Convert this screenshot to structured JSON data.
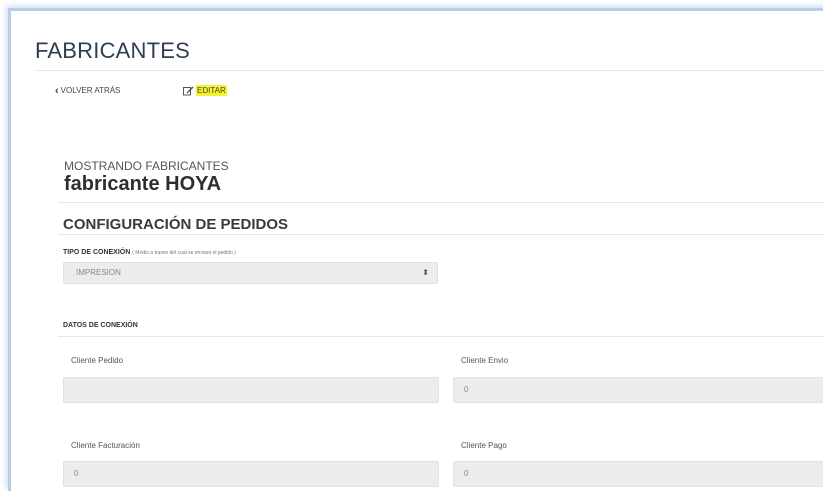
{
  "page": {
    "title": "FABRICANTES",
    "back_label": "VOLVER ATRÁS",
    "edit_label": "EDITAR"
  },
  "header": {
    "subtitle": "MOSTRANDO FABRICANTES",
    "entity_name": "fabricante HOYA"
  },
  "config": {
    "section_title": "CONFIGURACIÓN DE PEDIDOS",
    "connection_type_label": "TIPO DE CONEXIÓN",
    "connection_type_hint": "( Medio a traves del cual se enviará el pedido )",
    "connection_type_value": "IMPRESION"
  },
  "connection_data": {
    "label": "DATOS DE CONEXIÓN",
    "fields": [
      {
        "label": "Cliente Pedido",
        "value": ""
      },
      {
        "label": "Cliente Envio",
        "value": "0"
      },
      {
        "label": "Cliente Facturación",
        "value": "0"
      },
      {
        "label": "Cliente Pago",
        "value": "0"
      }
    ]
  },
  "colors": {
    "highlight": "#f7f230",
    "frame_border": "#b9cce6",
    "field_background": "#ececec"
  },
  "icons": {
    "back": "chevron-left-icon",
    "edit": "edit-icon",
    "select_arrow": "sort-arrows-icon"
  }
}
